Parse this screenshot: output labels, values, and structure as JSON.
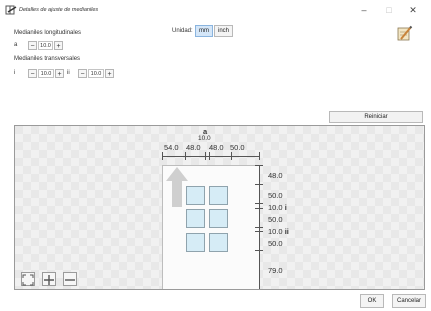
{
  "window": {
    "title": "Detalles de ajuste de medianiles",
    "minimize_glyph": "–",
    "maximize_glyph": "□",
    "close_glyph": "✕"
  },
  "settings": {
    "longitudinal_heading": "Medianiles longitudinales",
    "a_label": "a",
    "a_value": "10.0",
    "transverse_heading": "Medianiles transversales",
    "i_label": "i",
    "i_value": "10.0",
    "ii_label": "ii",
    "ii_value": "10.0",
    "minus": "−",
    "plus": "+"
  },
  "unit": {
    "label": "Unidad:",
    "options": [
      "mm",
      "inch"
    ],
    "selected": "mm"
  },
  "reset_label": "Reiniciar",
  "preview": {
    "top_label": "a",
    "top_gutter": "10.0",
    "top_dims": [
      "54.0",
      "48.0",
      "48.0",
      "50.0"
    ],
    "right_dims": [
      {
        "value": "48.0",
        "tag": ""
      },
      {
        "value": "50.0",
        "tag": ""
      },
      {
        "value": "10.0",
        "tag": "i"
      },
      {
        "value": "50.0",
        "tag": ""
      },
      {
        "value": "10.0",
        "tag": "ii"
      },
      {
        "value": "50.0",
        "tag": ""
      },
      {
        "value": "79.0",
        "tag": ""
      }
    ]
  },
  "footer": {
    "ok": "OK",
    "cancel": "Cancelar"
  },
  "icons": [
    "document-gutter-icon",
    "settings-pencil-icon",
    "fit-view-icon",
    "zoom-in-icon",
    "zoom-out-icon",
    "paper-feed-arrow-icon"
  ],
  "colors": {
    "accent": "#d4e6f8",
    "cell_fill": "#d6ecf6"
  }
}
